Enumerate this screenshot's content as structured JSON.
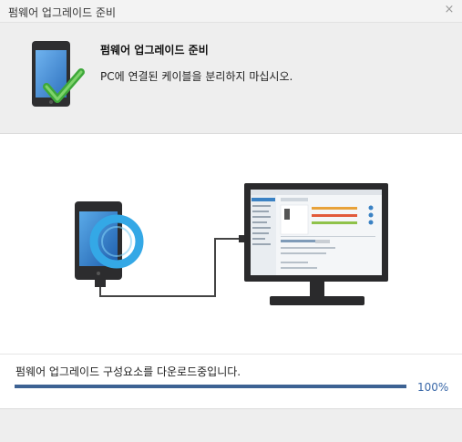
{
  "window": {
    "title": "펌웨어 업그레이드 준비",
    "close_glyph": "×"
  },
  "header": {
    "title": "펌웨어 업그레이드 준비",
    "description": "PC에 연결된 케이블을 분리하지 마십시오.",
    "icon": "phone-checkmark-icon"
  },
  "illustration": {
    "phone_icon": "phone-icon",
    "sync_icon": "refresh-icon",
    "monitor_icon": "monitor-icon"
  },
  "progress": {
    "status_text": "펌웨어 업그레이드 구성요소를 다운로드중입니다.",
    "percent_label": "100%",
    "value": 1.0,
    "fill_color": "#3d6293"
  }
}
